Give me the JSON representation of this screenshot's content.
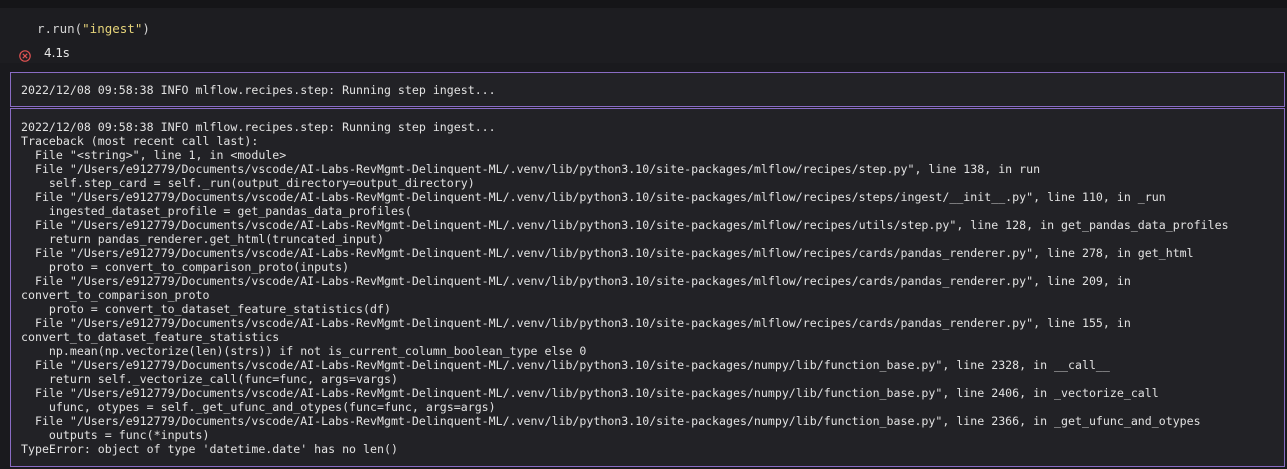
{
  "cell": {
    "code": {
      "prefix": "r.run(",
      "argument": "\"ingest\"",
      "suffix": ")"
    },
    "status": {
      "icon": "error-circle-x-icon",
      "elapsed": "4.1s",
      "color": "#e05252"
    }
  },
  "output": {
    "info_log": "2022/12/08 09:58:38 INFO mlflow.recipes.step: Running step ingest...",
    "traceback_lines": [
      "2022/12/08 09:58:38 INFO mlflow.recipes.step: Running step ingest...",
      "Traceback (most recent call last):",
      "  File \"<string>\", line 1, in <module>",
      "  File \"/Users/e912779/Documents/vscode/AI-Labs-RevMgmt-Delinquent-ML/.venv/lib/python3.10/site-packages/mlflow/recipes/step.py\", line 138, in run",
      "    self.step_card = self._run(output_directory=output_directory)",
      "  File \"/Users/e912779/Documents/vscode/AI-Labs-RevMgmt-Delinquent-ML/.venv/lib/python3.10/site-packages/mlflow/recipes/steps/ingest/__init__.py\", line 110, in _run",
      "    ingested_dataset_profile = get_pandas_data_profiles(",
      "  File \"/Users/e912779/Documents/vscode/AI-Labs-RevMgmt-Delinquent-ML/.venv/lib/python3.10/site-packages/mlflow/recipes/utils/step.py\", line 128, in get_pandas_data_profiles",
      "    return pandas_renderer.get_html(truncated_input)",
      "  File \"/Users/e912779/Documents/vscode/AI-Labs-RevMgmt-Delinquent-ML/.venv/lib/python3.10/site-packages/mlflow/recipes/cards/pandas_renderer.py\", line 278, in get_html",
      "    proto = convert_to_comparison_proto(inputs)",
      "  File \"/Users/e912779/Documents/vscode/AI-Labs-RevMgmt-Delinquent-ML/.venv/lib/python3.10/site-packages/mlflow/recipes/cards/pandas_renderer.py\", line 209, in",
      "convert_to_comparison_proto",
      "    proto = convert_to_dataset_feature_statistics(df)",
      "  File \"/Users/e912779/Documents/vscode/AI-Labs-RevMgmt-Delinquent-ML/.venv/lib/python3.10/site-packages/mlflow/recipes/cards/pandas_renderer.py\", line 155, in",
      "convert_to_dataset_feature_statistics",
      "    np.mean(np.vectorize(len)(strs)) if not is_current_column_boolean_type else 0",
      "  File \"/Users/e912779/Documents/vscode/AI-Labs-RevMgmt-Delinquent-ML/.venv/lib/python3.10/site-packages/numpy/lib/function_base.py\", line 2328, in __call__",
      "    return self._vectorize_call(func=func, args=vargs)",
      "  File \"/Users/e912779/Documents/vscode/AI-Labs-RevMgmt-Delinquent-ML/.venv/lib/python3.10/site-packages/numpy/lib/function_base.py\", line 2406, in _vectorize_call",
      "    ufunc, otypes = self._get_ufunc_and_otypes(func=func, args=args)",
      "  File \"/Users/e912779/Documents/vscode/AI-Labs-RevMgmt-Delinquent-ML/.venv/lib/python3.10/site-packages/numpy/lib/function_base.py\", line 2366, in _get_ufunc_and_otypes",
      "    outputs = func(*inputs)",
      "TypeError: object of type 'datetime.date' has no len()"
    ]
  },
  "theme": {
    "background": "#1a1a1e",
    "output_border": "#8a6cc4",
    "string_literal": "#e6d47a"
  }
}
